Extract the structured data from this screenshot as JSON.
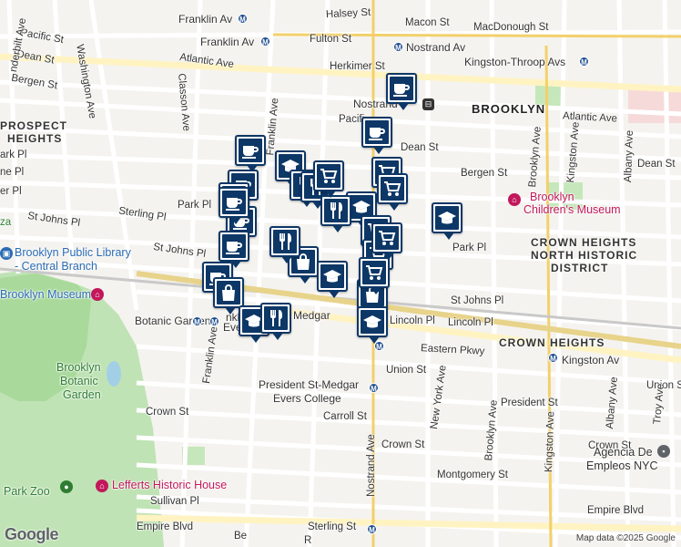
{
  "map": {
    "area_labels": {
      "brooklyn": "BROOKLYN",
      "prospect_heights_1": "PROSPECT",
      "prospect_heights_2": "HEIGHTS",
      "crown_heights_north_1": "CROWN HEIGHTS",
      "crown_heights_north_2": "NORTH HISTORIC",
      "crown_heights_north_3": "DISTRICT",
      "crown_heights": "CROWN HEIGHTS",
      "botanic_garden_1": "Brooklyn",
      "botanic_garden_2": "Botanic",
      "botanic_garden_3": "Garden"
    },
    "streets": {
      "franklin_av_top": "Franklin Av",
      "halsey_st": "Halsey St",
      "macon_st": "Macon St",
      "macdonough_st": "MacDonough St",
      "pacific_st": "Pacific St",
      "fulton_st": "Fulton St",
      "nostrand_av_top": "Nostrand Av",
      "franklin_av_2": "Franklin Av",
      "kingston_throop": "Kingston-Throop Avs",
      "dean_st_w": "Dean St",
      "atlantic_av_w": "Atlantic Ave",
      "herkimer_st": "Herkimer St",
      "bergen_st_w": "Bergen St",
      "nostrand_2": "Nostrand",
      "atlantic_av_e": "Atlantic Ave",
      "pacific_mid": "Pacifi",
      "dean_st_mid": "Dean St",
      "dean_st_e": "Dean St",
      "bergen_st_e": "Bergen St",
      "park_pl_w": "Park Pl",
      "park_w_edge": "ark Pl",
      "park_pl_e": "Park Pl",
      "sterling_pl": "Sterling Pl",
      "st_johns_pl_w": "St Johns Pl",
      "st_johns_pl_mid": "St Johns Pl",
      "st_johns_pl_e": "St Johns Pl",
      "lincoln_pl_1": "Lincoln Pl",
      "lincoln_pl_2": "Lincoln Pl",
      "eastern_pkwy": "Eastern Pkwy",
      "kingston_av_station": "Kingston Av",
      "union_st": "Union St",
      "union_st_e": "Union St",
      "president_st": "President St",
      "president_st_medgar": "President St-Medgar",
      "evers_college": "Evers College",
      "carroll_st": "Carroll St",
      "crown_st_w": "Crown St",
      "crown_st_mid": "Crown St",
      "crown_st_e": "Crown St",
      "montgomery_st": "Montgomery St",
      "sullivan_pl": "Sullivan Pl",
      "empire_blvd_w": "Empire Blvd",
      "empire_blvd_e": "Empire Blvd",
      "sterling_st": "Sterling St",
      "classon_ave": "Classon Ave",
      "washington_ave": "Washington Ave",
      "franklin_ave_v": "Franklin Ave",
      "nostrand_ave_v": "Nostrand Ave",
      "new_york_ave": "New York Ave",
      "brooklyn_ave": "Brooklyn Ave",
      "kingston_ave": "Kingston Ave",
      "albany_ave": "Albany Ave",
      "troy_ave": "Troy Ave",
      "brooklyn_ave_upper": "Brooklyn Ave",
      "kingston_ave_upper": "Kingston Ave",
      "albany_ave_upper": "Albany Ave",
      "vanderbilt_ave": "nderbilt Ave",
      "botanic_garden_station": "Botanic Garden",
      "medgar_near": "Medgar",
      "franklin_near": "nklin Av",
      "evers_near": "Ever",
      "ne_pl": "ne Pl",
      "er_pl": "er Pl",
      "plaza": "za",
      "trunc_st_johns": "St Johns Pl",
      "bedford_trunc": "Be",
      "rogers_trunc": "R"
    },
    "pois": {
      "library_1": "Brooklyn Public Library",
      "library_2": "- Central Branch",
      "brooklyn_museum": "Brooklyn Museum",
      "childrens_museum_1": "Brooklyn",
      "childrens_museum_2": "Children's Museum",
      "lefferts": "Lefferts Historic House",
      "park_zoo": "Park Zoo",
      "agencia_1": "Agencia De",
      "agencia_2": "Empleos NYC"
    },
    "markers": [
      {
        "icon": "cup"
      },
      {
        "icon": "cup"
      },
      {
        "icon": "cup"
      },
      {
        "icon": "cup"
      },
      {
        "icon": "cup"
      },
      {
        "icon": "cup"
      },
      {
        "icon": "cup"
      },
      {
        "icon": "bag"
      },
      {
        "icon": "bag"
      },
      {
        "icon": "bag"
      },
      {
        "icon": "bag"
      },
      {
        "icon": "school"
      },
      {
        "icon": "school"
      },
      {
        "icon": "school"
      },
      {
        "icon": "school"
      },
      {
        "icon": "school"
      },
      {
        "icon": "school"
      },
      {
        "icon": "dining"
      },
      {
        "icon": "dining"
      },
      {
        "icon": "dining"
      },
      {
        "icon": "dining"
      },
      {
        "icon": "dining"
      },
      {
        "icon": "cart"
      },
      {
        "icon": "cart"
      },
      {
        "icon": "cart"
      },
      {
        "icon": "cart"
      },
      {
        "icon": "cart"
      },
      {
        "icon": "cart"
      },
      {
        "icon": "cart"
      },
      {
        "icon": "cup"
      }
    ],
    "attribution": "Map data ©2025 Google",
    "logo": "Google"
  }
}
